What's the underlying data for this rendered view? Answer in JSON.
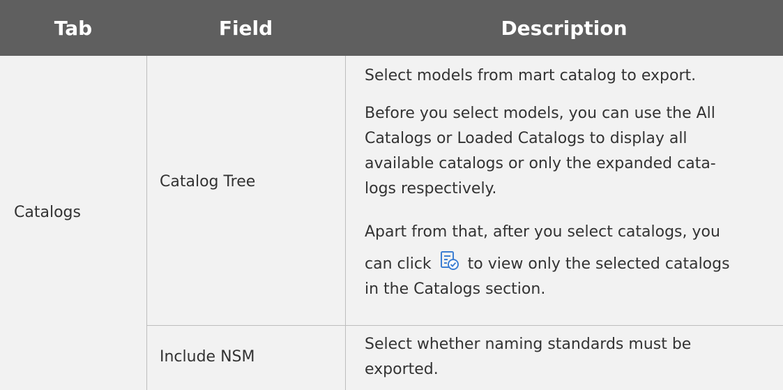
{
  "headers": {
    "tab": "Tab",
    "field": "Field",
    "description": "Description"
  },
  "tab_cell": "Catalogs",
  "rows": [
    {
      "field": "Catalog Tree",
      "description": {
        "p1": "Select models from mart catalog to export.",
        "p2_lines": [
          "Before you select models, you can use the All",
          "Catalogs or Loaded Catalogs to display all",
          "available catalogs or only the expanded cata-",
          "logs respectively."
        ],
        "p3_line1": "Apart from that, after you select catalogs, you",
        "p3_line2_before_icon": "can click",
        "p3_icon": "selected-catalogs-filter-icon",
        "p3_line2_after_icon": "to view only the selected catalogs",
        "p3_line3": "in the Catalogs section."
      }
    },
    {
      "field": "Include NSM",
      "description": {
        "lines": [
          "Select whether naming standards must be",
          "exported."
        ]
      }
    }
  ],
  "colors": {
    "header_bg": "#5f5f5f",
    "header_text": "#ffffff",
    "body_bg": "#f2f2f2",
    "border": "#bdbdbd",
    "icon_blue": "#3d7fd3"
  }
}
